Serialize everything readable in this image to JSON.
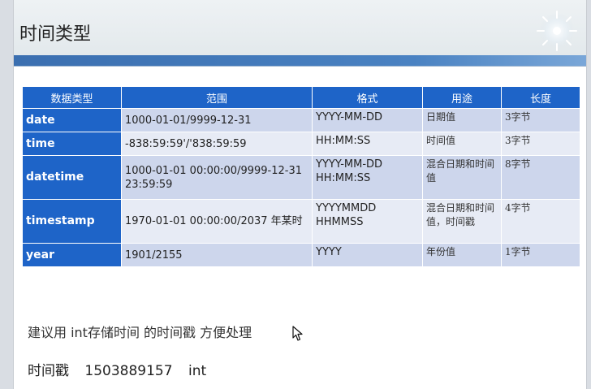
{
  "slide": {
    "title": "时间类型",
    "note": "建议用 int存储时间 的时间戳 方便处理",
    "timestamp_label": "时间戳",
    "timestamp_value": "1503889157",
    "timestamp_type": "int"
  },
  "table": {
    "headers": [
      "数据类型",
      "范围",
      "格式",
      "用途",
      "长度"
    ],
    "rows": [
      {
        "type": "date",
        "range": "1000-01-01/9999-12-31",
        "format": "YYYY-MM-DD",
        "use": "日期值",
        "length": "3字节"
      },
      {
        "type": "time",
        "range": "-838:59:59'/'838:59:59",
        "format": "HH:MM:SS",
        "use": "时间值",
        "length": "3字节"
      },
      {
        "type": "datetime",
        "range": "1000-01-01 00:00:00/9999-12-31 23:59:59",
        "format": "YYYY-MM-DD HH:MM:SS",
        "use": "混合日期和时间值",
        "length": "8字节"
      },
      {
        "type": "timestamp",
        "range": "1970-01-01 00:00:00/2037 年某时",
        "format": "YYYYMMDD HHMMSS",
        "use": "混合日期和时间值，时间戳",
        "length": "4字节"
      },
      {
        "type": "year",
        "range": "1901/2155",
        "format": "YYYY",
        "use": "年份值",
        "length": "1字节"
      }
    ]
  },
  "colors": {
    "header_blue": "#1e64c8",
    "row_dark": "#cdd6ec",
    "row_light": "#e7ebf5",
    "title_bar": "#3b6fb0"
  },
  "icons": {
    "corner": "sparkle-icon",
    "pointer": "cursor-icon"
  }
}
